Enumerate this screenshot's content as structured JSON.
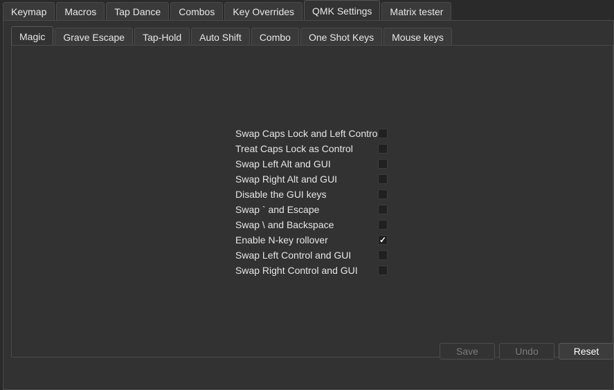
{
  "top_tabs": [
    {
      "label": "Keymap",
      "active": false
    },
    {
      "label": "Macros",
      "active": false
    },
    {
      "label": "Tap Dance",
      "active": false
    },
    {
      "label": "Combos",
      "active": false
    },
    {
      "label": "Key Overrides",
      "active": false
    },
    {
      "label": "QMK Settings",
      "active": true
    },
    {
      "label": "Matrix tester",
      "active": false
    }
  ],
  "inner_tabs": [
    {
      "label": "Magic",
      "active": true
    },
    {
      "label": "Grave Escape",
      "active": false
    },
    {
      "label": "Tap-Hold",
      "active": false
    },
    {
      "label": "Auto Shift",
      "active": false
    },
    {
      "label": "Combo",
      "active": false
    },
    {
      "label": "One Shot Keys",
      "active": false
    },
    {
      "label": "Mouse keys",
      "active": false
    }
  ],
  "settings": [
    {
      "label": "Swap Caps Lock and Left Control",
      "checked": false
    },
    {
      "label": "Treat Caps Lock as Control",
      "checked": false
    },
    {
      "label": "Swap Left Alt and GUI",
      "checked": false
    },
    {
      "label": "Swap Right Alt and GUI",
      "checked": false
    },
    {
      "label": "Disable the GUI keys",
      "checked": false
    },
    {
      "label": "Swap ` and Escape",
      "checked": false
    },
    {
      "label": "Swap \\ and Backspace",
      "checked": false
    },
    {
      "label": "Enable N-key rollover",
      "checked": true
    },
    {
      "label": "Swap Left Control and GUI",
      "checked": false
    },
    {
      "label": "Swap Right Control and GUI",
      "checked": false
    }
  ],
  "buttons": {
    "save_label": "Save",
    "undo_label": "Undo",
    "reset_label": "Reset"
  },
  "check_glyph": "✓"
}
